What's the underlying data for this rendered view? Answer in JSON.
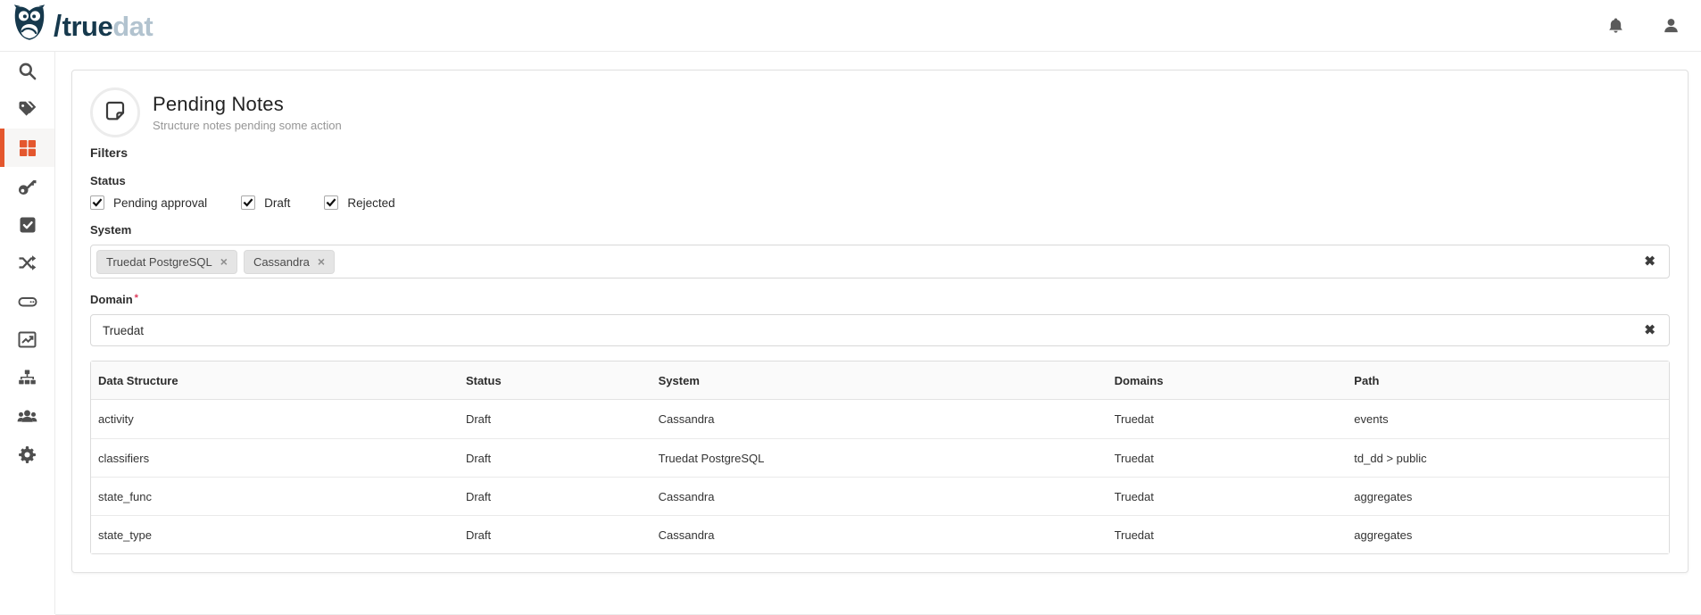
{
  "colors": {
    "accent": "#e4572e",
    "brand_dark": "#16394d",
    "brand_light": "#b2c3cf"
  },
  "brand": {
    "slash": "/",
    "name_primary": "true",
    "name_secondary": "dat"
  },
  "topbar": {
    "icons": [
      {
        "name": "notifications-bell"
      },
      {
        "name": "user-account"
      }
    ]
  },
  "icons": {
    "tag_remove": "×",
    "clear_field": "✖",
    "required_marker": "*"
  },
  "sidebar": {
    "items": [
      {
        "id": "search",
        "icon": "search-icon",
        "active": false
      },
      {
        "id": "glossary",
        "icon": "tags-icon",
        "active": false
      },
      {
        "id": "catalog",
        "icon": "grid-icon",
        "active": true
      },
      {
        "id": "access",
        "icon": "key-icon",
        "active": false
      },
      {
        "id": "quality",
        "icon": "check-square-icon",
        "active": false
      },
      {
        "id": "lineage",
        "icon": "shuffle-icon",
        "active": false
      },
      {
        "id": "systems",
        "icon": "drive-icon",
        "active": false
      },
      {
        "id": "dashboards",
        "icon": "chart-line-icon",
        "active": false
      },
      {
        "id": "domains",
        "icon": "sitemap-icon",
        "active": false
      },
      {
        "id": "users",
        "icon": "users-icon",
        "active": false
      },
      {
        "id": "configuration",
        "icon": "gear-icon",
        "active": false
      }
    ]
  },
  "page": {
    "title": "Pending Notes",
    "subtitle": "Structure notes pending some action",
    "filters_label": "Filters",
    "status": {
      "label": "Status",
      "options": [
        {
          "label": "Pending approval",
          "checked": true
        },
        {
          "label": "Draft",
          "checked": true
        },
        {
          "label": "Rejected",
          "checked": true
        }
      ]
    },
    "system": {
      "label": "System",
      "selected": [
        {
          "label": "Truedat PostgreSQL"
        },
        {
          "label": "Cassandra"
        }
      ]
    },
    "domain": {
      "label": "Domain",
      "required": true,
      "value": "Truedat"
    },
    "table": {
      "columns": [
        "Data Structure",
        "Status",
        "System",
        "Domains",
        "Path"
      ],
      "rows": [
        [
          "activity",
          "Draft",
          "Cassandra",
          "Truedat",
          "events"
        ],
        [
          "classifiers",
          "Draft",
          "Truedat PostgreSQL",
          "Truedat",
          "td_dd > public"
        ],
        [
          "state_func",
          "Draft",
          "Cassandra",
          "Truedat",
          "aggregates"
        ],
        [
          "state_type",
          "Draft",
          "Cassandra",
          "Truedat",
          "aggregates"
        ]
      ]
    }
  }
}
